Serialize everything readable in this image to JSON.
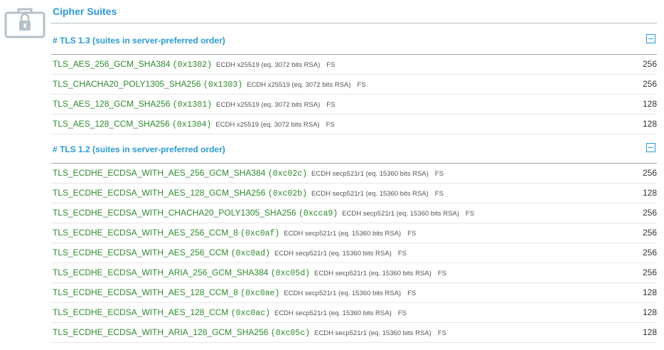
{
  "section": {
    "title": "Cipher Suites",
    "icon": "lock-case-icon"
  },
  "colors": {
    "accent": "#2a9bd0",
    "suite": "#2e8b2e"
  },
  "groups": [
    {
      "header": "# TLS 1.3 (suites in server-preferred order)",
      "rows": [
        {
          "name": "TLS_AES_256_GCM_SHA384",
          "code": "(0x1302)",
          "meta": "ECDH x25519 (eq. 3072 bits RSA)",
          "fs": "FS",
          "bits": "256"
        },
        {
          "name": "TLS_CHACHA20_POLY1305_SHA256",
          "code": "(0x1303)",
          "meta": "ECDH x25519 (eq. 3072 bits RSA)",
          "fs": "FS",
          "bits": "256"
        },
        {
          "name": "TLS_AES_128_GCM_SHA256",
          "code": "(0x1301)",
          "meta": "ECDH x25519 (eq. 3072 bits RSA)",
          "fs": "FS",
          "bits": "128"
        },
        {
          "name": "TLS_AES_128_CCM_SHA256",
          "code": "(0x1304)",
          "meta": "ECDH x25519 (eq. 3072 bits RSA)",
          "fs": "FS",
          "bits": "128"
        }
      ]
    },
    {
      "header": "# TLS 1.2 (suites in server-preferred order)",
      "rows": [
        {
          "name": "TLS_ECDHE_ECDSA_WITH_AES_256_GCM_SHA384",
          "code": "(0xc02c)",
          "meta": "ECDH secp521r1 (eq. 15360 bits RSA)",
          "fs": "FS",
          "bits": "256"
        },
        {
          "name": "TLS_ECDHE_ECDSA_WITH_AES_128_GCM_SHA256",
          "code": "(0xc02b)",
          "meta": "ECDH secp521r1 (eq. 15360 bits RSA)",
          "fs": "FS",
          "bits": "128"
        },
        {
          "name": "TLS_ECDHE_ECDSA_WITH_CHACHA20_POLY1305_SHA256",
          "code": "(0xcca9)",
          "meta": "ECDH secp521r1 (eq. 15360 bits RSA)",
          "fs": "FS",
          "bits": "256"
        },
        {
          "name": "TLS_ECDHE_ECDSA_WITH_AES_256_CCM_8",
          "code": "(0xc0af)",
          "meta": "ECDH secp521r1 (eq. 15360 bits RSA)",
          "fs": "FS",
          "bits": "256"
        },
        {
          "name": "TLS_ECDHE_ECDSA_WITH_AES_256_CCM",
          "code": "(0xc0ad)",
          "meta": "ECDH secp521r1 (eq. 15360 bits RSA)",
          "fs": "FS",
          "bits": "256"
        },
        {
          "name": "TLS_ECDHE_ECDSA_WITH_ARIA_256_GCM_SHA384",
          "code": "(0xc05d)",
          "meta": "ECDH secp521r1 (eq. 15360 bits RSA)",
          "fs": "FS",
          "bits": "256"
        },
        {
          "name": "TLS_ECDHE_ECDSA_WITH_AES_128_CCM_8",
          "code": "(0xc0ae)",
          "meta": "ECDH secp521r1 (eq. 15360 bits RSA)",
          "fs": "FS",
          "bits": "128"
        },
        {
          "name": "TLS_ECDHE_ECDSA_WITH_AES_128_CCM",
          "code": "(0xc0ac)",
          "meta": "ECDH secp521r1 (eq. 15360 bits RSA)",
          "fs": "FS",
          "bits": "128"
        },
        {
          "name": "TLS_ECDHE_ECDSA_WITH_ARIA_128_GCM_SHA256",
          "code": "(0xc05c)",
          "meta": "ECDH secp521r1 (eq. 15360 bits RSA)",
          "fs": "FS",
          "bits": "128"
        }
      ]
    }
  ]
}
